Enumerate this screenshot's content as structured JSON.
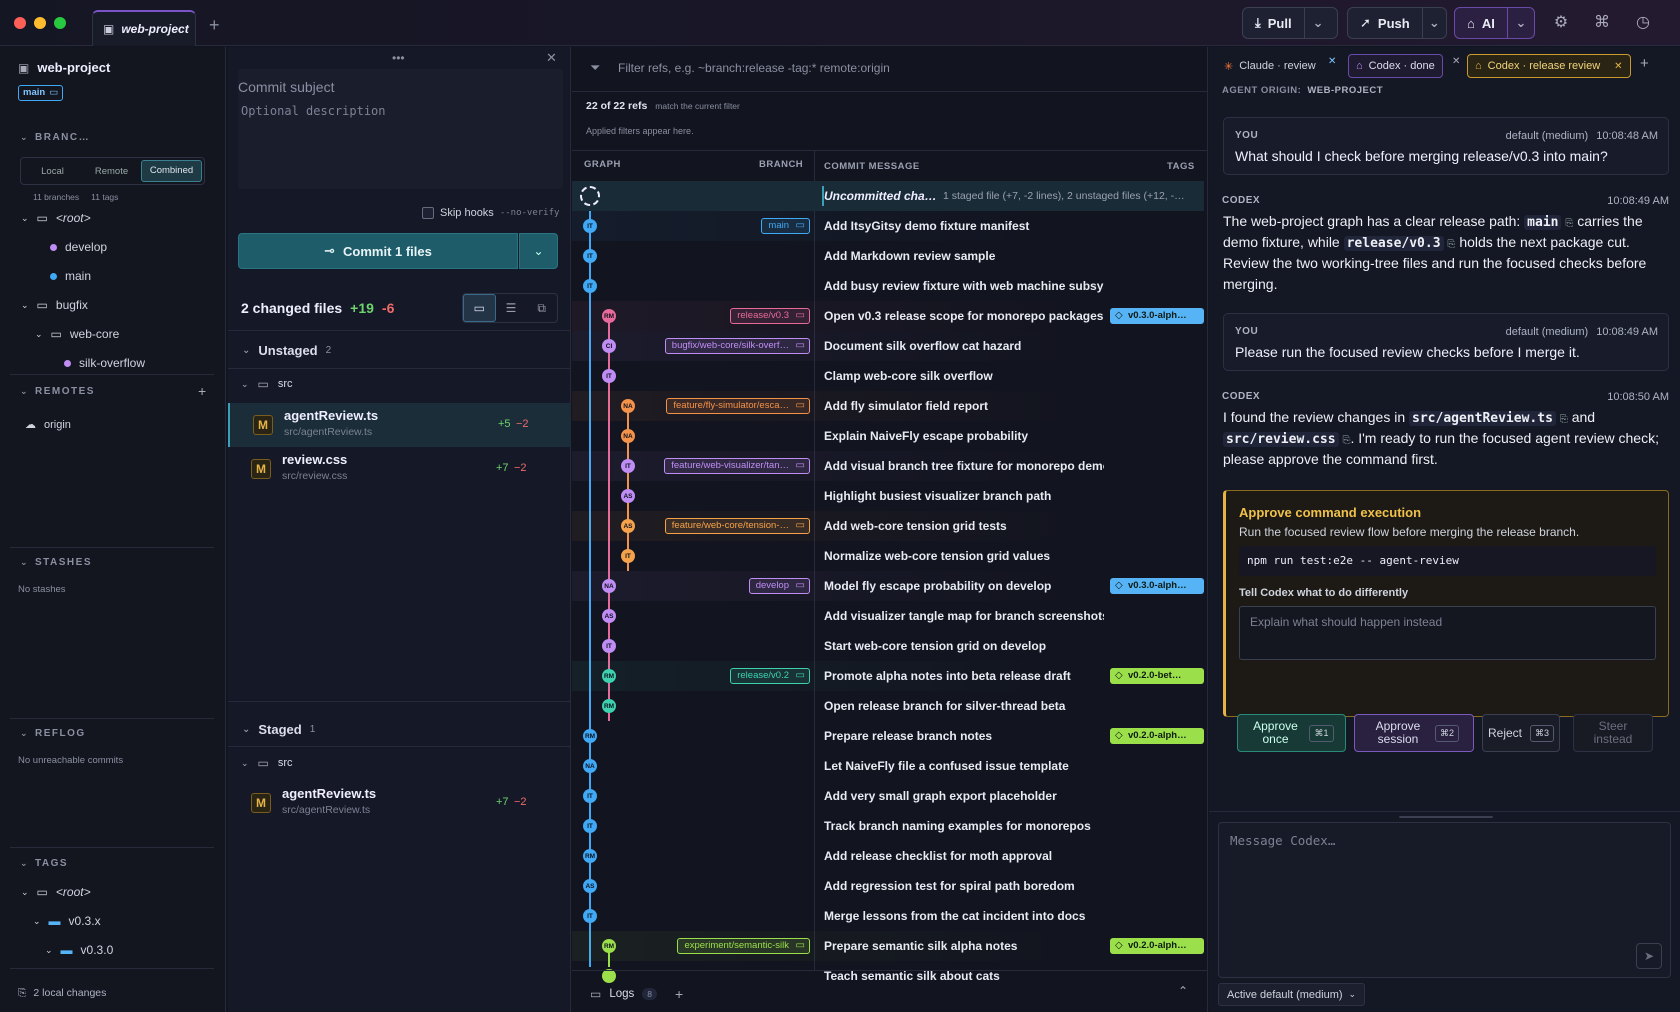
{
  "window": {
    "tab_title": "web-project",
    "new_tab": "+"
  },
  "toolbar": {
    "pull": "Pull",
    "push": "Push",
    "ai": "AI"
  },
  "sidebar": {
    "repo": "web-project",
    "branch_badge": "main",
    "branches_header": "BRANC…",
    "scope": [
      "Local",
      "Remote",
      "Combined"
    ],
    "counts": {
      "branches": "11 branches",
      "tags": "11 tags"
    },
    "tree": {
      "root": "<root>",
      "develop": "develop",
      "main": "main",
      "bugfix": "bugfix",
      "webcore": "web-core",
      "silk": "silk-overflow"
    },
    "remotes_header": "REMOTES",
    "origin": "origin",
    "stashes_header": "STASHES",
    "no_stashes": "No stashes",
    "reflog_header": "REFLOG",
    "no_reflog": "No unreachable commits",
    "tags_header": "TAGS",
    "tag_root": "<root>",
    "tag_v03x": "v0.3.x",
    "tag_v030": "v0.3.0",
    "local_changes": "2 local changes"
  },
  "commit": {
    "subject": "Commit subject",
    "description": "Optional description",
    "skip_hooks": "Skip hooks",
    "no_verify": "--no-verify",
    "commit_btn": "Commit 1 files",
    "changed": "2 changed files",
    "added": "+19",
    "removed": "-6",
    "unstaged": "Unstaged",
    "unstaged_count": "2",
    "staged": "Staged",
    "staged_count": "1",
    "src": "src",
    "files": [
      {
        "name": "agentReview.ts",
        "path": "src/agentReview.ts",
        "add": "+5",
        "del": "−2"
      },
      {
        "name": "review.css",
        "path": "src/review.css",
        "add": "+7",
        "del": "−2"
      },
      {
        "name": "agentReview.ts",
        "path": "src/agentReview.ts",
        "add": "+7",
        "del": "−2"
      }
    ],
    "badge": "M"
  },
  "graph": {
    "filter_placeholder": "Filter refs, e.g. ~branch:release -tag:* remote:origin",
    "refs": "22 of 22 refs",
    "refs_note": "match the current filter",
    "applied": "Applied filters appear here.",
    "headers": {
      "graph": "GRAPH",
      "branch": "BRANCH",
      "message": "COMMIT MESSAGE",
      "tags": "TAGS"
    },
    "uncommitted": "Uncommitted cha…",
    "uncommitted_detail": "1 staged file (+7, -2 lines), 2 unstaged files (+12, -…",
    "rows": [
      {
        "msg": "Add ItsyGitsy demo fixture manifest",
        "node": "IT",
        "col": 0,
        "color": "#3fa9f5",
        "branch": "main",
        "bcolor": "#3fa9f5"
      },
      {
        "msg": "Add Markdown review sample",
        "node": "IT",
        "col": 0,
        "color": "#3fa9f5"
      },
      {
        "msg": "Add busy review fixture with web machine subsystem",
        "node": "IT",
        "col": 0,
        "color": "#3fa9f5"
      },
      {
        "msg": "Open v0.3 release scope for monorepo packages",
        "node": "RM",
        "col": 1,
        "color": "#e86a9a",
        "branch": "release/v0.3",
        "bcolor": "#e86a9a",
        "tag": "v0.3.0-alph…",
        "tcolor": "#56b3f5"
      },
      {
        "msg": "Document silk overflow cat hazard",
        "node": "CI",
        "col": 1,
        "color": "#c08df5",
        "branch": "bugfix/web-core/silk-overf…",
        "bcolor": "#c08df5"
      },
      {
        "msg": "Clamp web-core silk overflow",
        "node": "IT",
        "col": 1,
        "color": "#c08df5"
      },
      {
        "msg": "Add fly simulator field report",
        "node": "NA",
        "col": 2,
        "color": "#f5924a",
        "branch": "feature/fly-simulator/esca…",
        "bcolor": "#f5924a"
      },
      {
        "msg": "Explain NaiveFly escape probability",
        "node": "NA",
        "col": 2,
        "color": "#f5924a"
      },
      {
        "msg": "Add visual branch tree fixture for monorepo demo",
        "node": "IT",
        "col": 2,
        "color": "#c08df5",
        "branch": "feature/web-visualizer/tan…",
        "bcolor": "#c08df5"
      },
      {
        "msg": "Highlight busiest visualizer branch path",
        "node": "AS",
        "col": 2,
        "color": "#c08df5"
      },
      {
        "msg": "Add web-core tension grid tests",
        "node": "AS",
        "col": 2,
        "color": "#f5a24a",
        "branch": "feature/web-core/tension-…",
        "bcolor": "#f5a24a"
      },
      {
        "msg": "Normalize web-core tension grid values",
        "node": "IT",
        "col": 2,
        "color": "#f5a24a"
      },
      {
        "msg": "Model fly escape probability on develop",
        "node": "NA",
        "col": 1,
        "color": "#c08df5",
        "branch": "develop",
        "bcolor": "#c08df5",
        "tag": "v0.3.0-alph…",
        "tcolor": "#56b3f5"
      },
      {
        "msg": "Add visualizer tangle map for branch screenshots",
        "node": "AS",
        "col": 1,
        "color": "#c08df5"
      },
      {
        "msg": "Start web-core tension grid on develop",
        "node": "IT",
        "col": 1,
        "color": "#c08df5"
      },
      {
        "msg": "Promote alpha notes into beta release draft",
        "node": "RM",
        "col": 1,
        "color": "#3ed1b0",
        "branch": "release/v0.2",
        "bcolor": "#3ed1b0",
        "tag": "v0.2.0-bet…",
        "tcolor": "#9be04a"
      },
      {
        "msg": "Open release branch for silver-thread beta",
        "node": "RM",
        "col": 1,
        "color": "#3ed1b0"
      },
      {
        "msg": "Prepare release branch notes",
        "node": "RM",
        "col": 0,
        "color": "#3fa9f5",
        "tag": "v0.2.0-alph…",
        "tcolor": "#9be04a"
      },
      {
        "msg": "Let NaiveFly file a confused issue template",
        "node": "NA",
        "col": 0,
        "color": "#3fa9f5"
      },
      {
        "msg": "Add very small graph export placeholder",
        "node": "IT",
        "col": 0,
        "color": "#3fa9f5"
      },
      {
        "msg": "Track branch naming examples for monorepos",
        "node": "IT",
        "col": 0,
        "color": "#3fa9f5"
      },
      {
        "msg": "Add release checklist for moth approval",
        "node": "RM",
        "col": 0,
        "color": "#3fa9f5"
      },
      {
        "msg": "Add regression test for spiral path boredom",
        "node": "AS",
        "col": 0,
        "color": "#3fa9f5"
      },
      {
        "msg": "Merge lessons from the cat incident into docs",
        "node": "IT",
        "col": 0,
        "color": "#3fa9f5"
      },
      {
        "msg": "Prepare semantic silk alpha notes",
        "node": "RM",
        "col": 1,
        "color": "#9be04a",
        "branch": "experiment/semantic-silk",
        "bcolor": "#9be04a",
        "tag": "v0.2.0-alph…",
        "tcolor": "#9be04a"
      },
      {
        "msg": "Teach semantic silk about cats",
        "node": "",
        "col": 1,
        "color": "#9be04a"
      }
    ],
    "logs": "Logs",
    "logs_count": "8"
  },
  "agent": {
    "tabs": [
      "Claude · review",
      "Codex · done",
      "Codex · release review"
    ],
    "origin_label": "AGENT ORIGIN:",
    "origin": "WEB-PROJECT",
    "you": "YOU",
    "codex": "CODEX",
    "mode": "default (medium)",
    "m1": {
      "time": "10:08:48 AM",
      "text": "What should I check before merging release/v0.3 into main?"
    },
    "m2": {
      "time": "10:08:49 AM",
      "a": "The web-project graph has a clear release path:",
      "main": "main",
      "b": "carries the",
      "c": "demo fixture, while",
      "rel": "release/v0.3",
      "d": "holds the next package cut.",
      "e": "Review the two working-tree files and run the focused checks before",
      "f": "merging."
    },
    "m3": {
      "time": "10:08:49 AM",
      "text": "Please run the focused review checks before I merge it."
    },
    "m4": {
      "time": "10:08:50 AM",
      "a": "I found the review changes in",
      "f1": "src/agentReview.ts",
      "b": "and",
      "f2": "src/review.css",
      "c": ". I'm ready to run the focused agent review check;",
      "d": "please approve the command first."
    },
    "approve": {
      "title": "Approve command execution",
      "desc": "Run the focused review flow before merging the release branch.",
      "cmd": "npm run test:e2e -- agent-review",
      "label": "Tell Codex what to do differently",
      "placeholder": "Explain what should happen instead",
      "once": "Approve once",
      "once_k": "⌘1",
      "session": "Approve session",
      "session_k": "⌘2",
      "reject": "Reject",
      "reject_k": "⌘3",
      "steer": "Steer instead"
    },
    "input_placeholder": "Message Codex…",
    "status": "Active default (medium)"
  }
}
